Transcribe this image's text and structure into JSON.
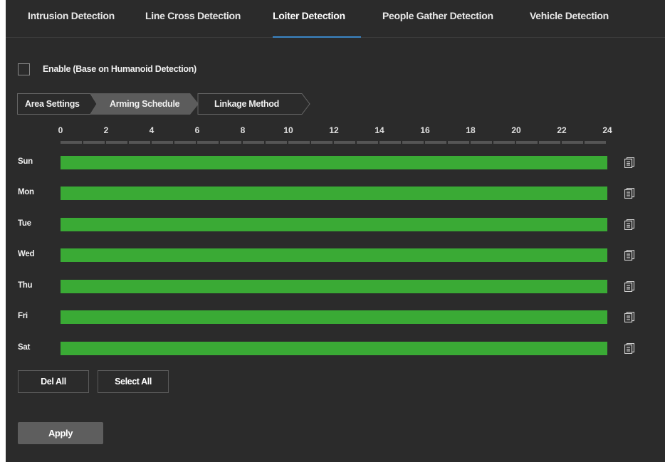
{
  "tabs": [
    {
      "label": "Intrusion Detection",
      "active": false
    },
    {
      "label": "Line Cross Detection",
      "active": false
    },
    {
      "label": "Loiter Detection",
      "active": true
    },
    {
      "label": "People Gather Detection",
      "active": false
    },
    {
      "label": "Vehicle Detection",
      "active": false
    }
  ],
  "enable": {
    "label": "Enable (Base on Humanoid Detection)",
    "checked": false
  },
  "steps": [
    {
      "label": "Area Settings"
    },
    {
      "label": "Arming Schedule",
      "active": true
    },
    {
      "label": "Linkage Method"
    }
  ],
  "schedule": {
    "hour_labels": [
      "0",
      "2",
      "4",
      "6",
      "8",
      "10",
      "12",
      "14",
      "16",
      "18",
      "20",
      "22",
      "24"
    ],
    "days": [
      {
        "label": "Sun",
        "armed_from_hour": 0,
        "armed_to_hour": 24,
        "copy_icon": "copy-icon"
      },
      {
        "label": "Mon",
        "armed_from_hour": 0,
        "armed_to_hour": 24,
        "copy_icon": "copy-icon"
      },
      {
        "label": "Tue",
        "armed_from_hour": 0,
        "armed_to_hour": 24,
        "copy_icon": "copy-icon"
      },
      {
        "label": "Wed",
        "armed_from_hour": 0,
        "armed_to_hour": 24,
        "copy_icon": "copy-icon"
      },
      {
        "label": "Thu",
        "armed_from_hour": 0,
        "armed_to_hour": 24,
        "copy_icon": "copy-icon"
      },
      {
        "label": "Fri",
        "armed_from_hour": 0,
        "armed_to_hour": 24,
        "copy_icon": "copy-icon"
      },
      {
        "label": "Sat",
        "armed_from_hour": 0,
        "armed_to_hour": 24,
        "copy_icon": "copy-icon"
      }
    ],
    "armed_color": "#3aaa35"
  },
  "buttons": {
    "del_all": "Del All",
    "select_all": "Select All",
    "apply": "Apply"
  },
  "colors": {
    "background": "#2b2b2b",
    "tab_active_underline": "#3b86c6",
    "apply_button": "#5e5e5e"
  }
}
